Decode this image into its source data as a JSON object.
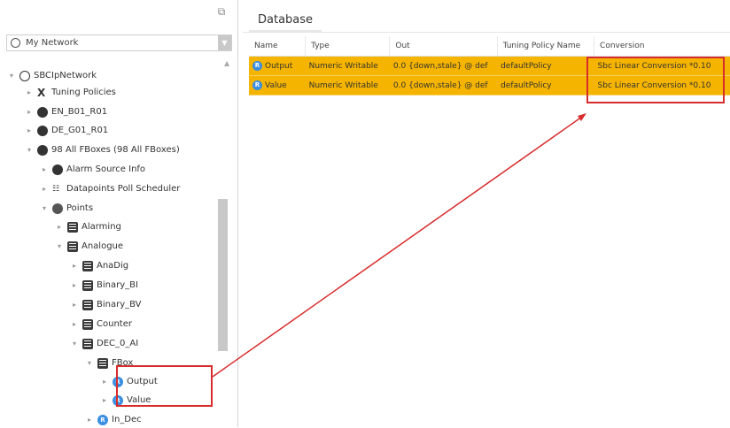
{
  "navigator": {
    "network_selector": "My Network",
    "tree": [
      {
        "label": "SBCIpNetwork",
        "icon": "network-icon",
        "level": 0,
        "twisty": "open"
      },
      {
        "label": "Tuning Policies",
        "icon": "tuning-icon",
        "level": 1,
        "twisty": "closed"
      },
      {
        "label": "EN_B01_R01",
        "icon": "device-icon",
        "level": 1,
        "twisty": "closed"
      },
      {
        "label": "DE_G01_R01",
        "icon": "device-icon",
        "level": 1,
        "twisty": "closed"
      },
      {
        "label": "98 All FBoxes (98 All FBoxes)",
        "icon": "device-icon",
        "level": 1,
        "twisty": "open"
      },
      {
        "label": "Alarm Source Info",
        "icon": "alarm-icon",
        "level": 2,
        "twisty": "closed"
      },
      {
        "label": "Datapoints Poll Scheduler",
        "icon": "poll-icon",
        "level": 2,
        "twisty": "closed"
      },
      {
        "label": "Points",
        "icon": "points-icon",
        "level": 2,
        "twisty": "open"
      },
      {
        "label": "Alarming",
        "icon": "folder-icon",
        "level": 3,
        "twisty": "closed"
      },
      {
        "label": "Analogue",
        "icon": "folder-icon",
        "level": 3,
        "twisty": "open"
      },
      {
        "label": "AnaDig",
        "icon": "folder-icon",
        "level": 4,
        "twisty": "closed"
      },
      {
        "label": "Binary_BI",
        "icon": "folder-icon",
        "level": 4,
        "twisty": "closed"
      },
      {
        "label": "Binary_BV",
        "icon": "folder-icon",
        "level": 4,
        "twisty": "closed"
      },
      {
        "label": "Counter",
        "icon": "folder-icon",
        "level": 4,
        "twisty": "closed"
      },
      {
        "label": "DEC_0_AI",
        "icon": "folder-icon",
        "level": 4,
        "twisty": "open"
      },
      {
        "label": "FBox",
        "icon": "folder-icon",
        "level": 5,
        "twisty": "open"
      },
      {
        "label": "Output",
        "icon": "numeric-point-icon",
        "level": 6,
        "twisty": "closed"
      },
      {
        "label": "Value",
        "icon": "numeric-point-icon",
        "level": 6,
        "twisty": "closed"
      },
      {
        "label": "In_Dec",
        "icon": "numeric-point-icon",
        "level": 5,
        "twisty": "closed"
      }
    ]
  },
  "database": {
    "tab_label": "Database",
    "columns": [
      "Name",
      "Type",
      "Out",
      "Tuning Policy Name",
      "Conversion"
    ],
    "rows": [
      {
        "name": "Output",
        "type": "Numeric Writable",
        "out": "0.0 {down,stale} @ def",
        "tuning": "defaultPolicy",
        "conversion": "Sbc Linear Conversion *0.10"
      },
      {
        "name": "Value",
        "type": "Numeric Writable",
        "out": "0.0 {down,stale} @ def",
        "tuning": "defaultPolicy",
        "conversion": "Sbc Linear Conversion *0.10"
      }
    ]
  },
  "colors": {
    "row_highlight": "#f5b400",
    "annotation": "#d82c2c",
    "point_icon": "#3b8ee0"
  }
}
